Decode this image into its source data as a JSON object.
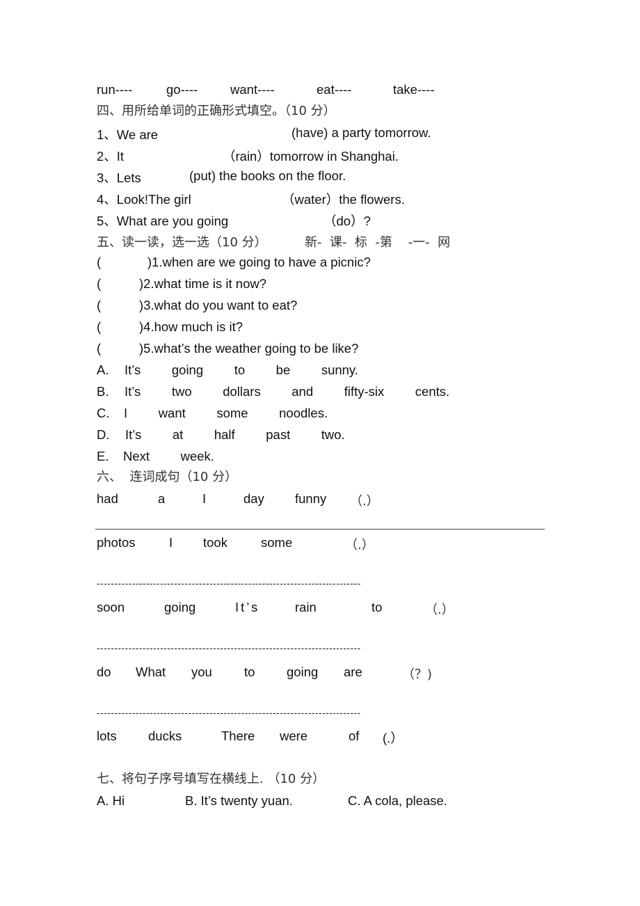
{
  "verbs_row": [
    "run----",
    "go----",
    "want----",
    "eat----",
    "take----"
  ],
  "section4": {
    "heading": "四、用所给单词的正确形式填空。（10 分）",
    "items": [
      {
        "num": "1、We are",
        "rest": "(have) a party tomorrow."
      },
      {
        "num": "2、It",
        "rest": "（rain）tomorrow in Shanghai."
      },
      {
        "num": "3、Lets",
        "rest": "(put) the books on the floor."
      },
      {
        "num": "4、Look!The girl",
        "rest": "（water）the flowers."
      },
      {
        "num": "5、What are you going",
        "rest": "（do）?"
      }
    ]
  },
  "section5": {
    "heading": "五、读一读，选一选（10 分）",
    "watermark": "新-  课-  标  -第    -一-  网",
    "questions": [
      {
        "paren": "(",
        "text": ")1.when are we going to have a picnic?"
      },
      {
        "paren": "(",
        "text": ")2.what time is it now?"
      },
      {
        "paren": "(",
        "text": ")3.what do you want to eat?"
      },
      {
        "paren": "(",
        "text": ")4.how much is it?"
      },
      {
        "paren": "(",
        "text": ")5.what’s the weather going to be like?"
      }
    ],
    "options": [
      {
        "letter": "A.",
        "text": "It’s    going    to    be    sunny."
      },
      {
        "letter": "B.",
        "text": "It’s    two    dollars    and    fifty-six    cents."
      },
      {
        "letter": "C.",
        "text": "I    want    some    noodles."
      },
      {
        "letter": "D.",
        "text": "It’s    at    half    past    two."
      },
      {
        "letter": "E.",
        "text": "Next    week."
      }
    ]
  },
  "section6": {
    "heading": "六、  连词成句（10 分）",
    "rows": [
      {
        "words": [
          "had",
          "a",
          "I",
          "day",
          "funny",
          "（.）"
        ]
      },
      {
        "words": [
          "photos",
          "I",
          "took",
          "some",
          "（.）"
        ]
      },
      {
        "words": [
          "soon",
          "going",
          "It’s",
          "rain",
          "to",
          "（.）"
        ]
      },
      {
        "words": [
          "do",
          "What",
          "you",
          "to",
          "going",
          "are",
          "（？)"
        ]
      },
      {
        "words": [
          "lots",
          "ducks",
          "There",
          "were",
          "of",
          "(.）"
        ]
      }
    ],
    "dash_line": "---------------------------------------------------------------------------"
  },
  "section7": {
    "heading": "七、将句子序号填写在横线上. （10 分）",
    "options": [
      "A. Hi",
      "B. It’s twenty yuan.",
      "C. A cola, please."
    ]
  }
}
